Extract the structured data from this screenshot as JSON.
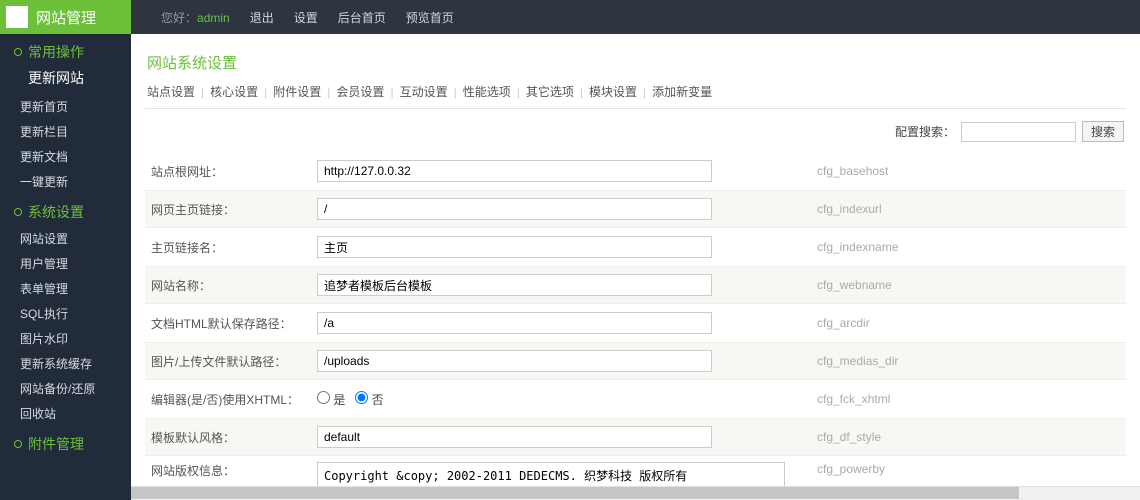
{
  "sidebar": {
    "title": "网站管理",
    "groups": [
      {
        "title": "常用操作",
        "first_link": "更新网站",
        "items": [
          "更新首页",
          "更新栏目",
          "更新文档",
          "一键更新"
        ]
      },
      {
        "title": "系统设置",
        "first_link": "",
        "items": [
          "网站设置",
          "用户管理",
          "表单管理",
          "SQL执行",
          "图片水印",
          "更新系统缓存",
          "网站备份/还原",
          "回收站"
        ]
      },
      {
        "title": "附件管理",
        "first_link": "",
        "items": []
      }
    ]
  },
  "topbar": {
    "greet": "您好：",
    "admin": "admin",
    "links": [
      "退出",
      "设置",
      "后台首页",
      "预览首页"
    ]
  },
  "panel": {
    "title": "网站系统设置",
    "tabs": [
      "站点设置",
      "核心设置",
      "附件设置",
      "会员设置",
      "互动设置",
      "性能选项",
      "其它选项",
      "模块设置",
      "添加新变量"
    ],
    "search_label": "配置搜索：",
    "search_btn": "搜索"
  },
  "rows": [
    {
      "label": "站点根网址：",
      "value": "http://127.0.0.32",
      "key": "cfg_basehost",
      "alt": false,
      "type": "text"
    },
    {
      "label": "网页主页链接：",
      "value": "/",
      "key": "cfg_indexurl",
      "alt": true,
      "type": "text"
    },
    {
      "label": "主页链接名：",
      "value": "主页",
      "key": "cfg_indexname",
      "alt": false,
      "type": "text"
    },
    {
      "label": "网站名称：",
      "value": "追梦者模板后台模板",
      "key": "cfg_webname",
      "alt": true,
      "type": "text"
    },
    {
      "label": "文档HTML默认保存路径：",
      "value": "/a",
      "key": "cfg_arcdir",
      "alt": false,
      "type": "text"
    },
    {
      "label": "图片/上传文件默认路径：",
      "value": "/uploads",
      "key": "cfg_medias_dir",
      "alt": true,
      "type": "text"
    },
    {
      "label": "编辑器(是/否)使用XHTML：",
      "value": "否",
      "options": [
        "是",
        "否"
      ],
      "key": "cfg_fck_xhtml",
      "alt": false,
      "type": "radio"
    },
    {
      "label": "模板默认风格：",
      "value": "default",
      "key": "cfg_df_style",
      "alt": true,
      "type": "text"
    },
    {
      "label": "网站版权信息：",
      "value": "Copyright &copy; 2002-2011 DEDECMS. 织梦科技 版权所有",
      "key": "cfg_powerby",
      "alt": false,
      "type": "textarea"
    }
  ]
}
